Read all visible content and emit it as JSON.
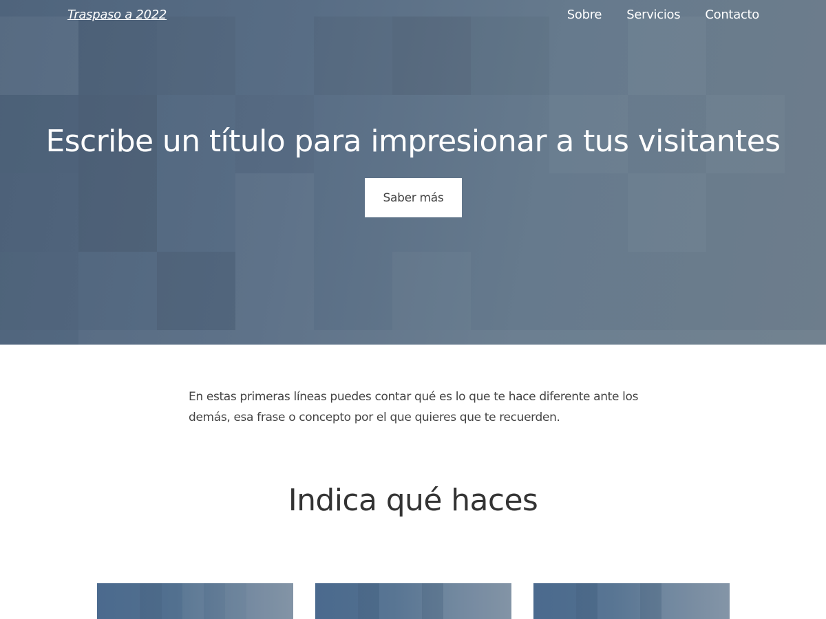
{
  "nav": {
    "logo": "Traspaso a 2022",
    "links": [
      "Sobre",
      "Servicios",
      "Contacto"
    ]
  },
  "hero": {
    "title": "Escribe un título para impresionar a tus visitantes",
    "button_label": "Saber más"
  },
  "intro": {
    "text": "En estas primeras líneas puedes contar qué es lo que te hace diferente ante los demás, esa frase o concepto por el que quieres que te recuerden."
  },
  "services": {
    "title": "Indica qué haces",
    "cards": [
      {
        "image": "service-image-1"
      },
      {
        "image": "service-image-2"
      },
      {
        "image": "service-image-3"
      }
    ]
  },
  "colors": {
    "hero_background": "#586d85",
    "text": "#444444",
    "button_background": "#ffffff"
  }
}
